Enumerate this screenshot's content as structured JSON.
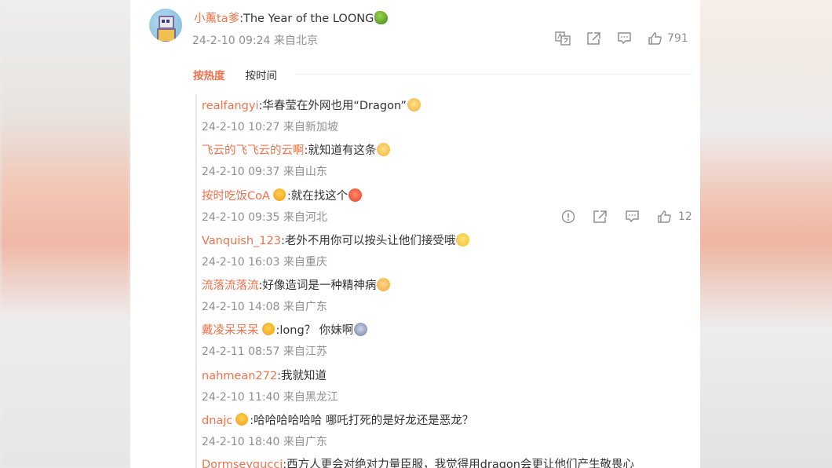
{
  "post": {
    "author": "小薰ta爹",
    "text": ":The Year of the LOONG",
    "emoji": "dragon-emoji",
    "meta": "24-2-10 09:24 来自北京",
    "like_count": "791",
    "icons": [
      "translate-icon",
      "share-icon",
      "comment-icon",
      "like-icon"
    ]
  },
  "tabs": {
    "hot": "按热度",
    "time": "按时间"
  },
  "replies": [
    {
      "user": "realfangyi",
      "text": ":华春莹在外网也用“Dragon”",
      "emoji": "cat",
      "meta": "24-2-10 10:27 来自新加坡",
      "badge": false
    },
    {
      "user": "飞云的飞飞云的云啊",
      "text": ":就知道有这条",
      "emoji": "cat",
      "meta": "24-2-10 09:37 来自山东",
      "badge": false
    },
    {
      "user": "按时吃饭CoA",
      "text": ":就在找这个",
      "emoji": "angry",
      "meta": "24-2-10 09:35 来自河北",
      "badge": true
    },
    {
      "user": "Vanquish_123",
      "text": ":老外不用你可以按头让他们接受哦",
      "emoji": "smile",
      "meta": "24-2-10 16:03 来自重庆",
      "badge": false
    },
    {
      "user": "流落流落流",
      "text": ":好像造词是一种精神病",
      "emoji": "clap",
      "meta": "24-2-10 14:08 来自广东",
      "badge": false
    },
    {
      "user": "戴凌呆呆呆",
      "text": ":long？ 你妹啊",
      "emoji": "mask",
      "meta": "24-2-11 08:57 来自江苏",
      "badge": true
    },
    {
      "user": "nahmean272",
      "text": ":我就知道",
      "emoji": "",
      "meta": "24-2-10 11:40 来自黑龙江",
      "badge": false
    },
    {
      "user": "dnajc",
      "text": ":哈哈哈哈哈哈 哪吒打死的是好龙还是恶龙？",
      "emoji": "",
      "meta": "24-2-10 18:40 来自广东",
      "badge": true
    },
    {
      "user": "Dormseyqucci",
      "text": ":西方人更会对绝对力量臣服，我觉得用dragon会更让他们产生敬畏心",
      "emoji": "",
      "meta": "",
      "badge": false
    }
  ],
  "reply_actions": {
    "like_count": "12",
    "icons": [
      "report-icon",
      "share-icon",
      "comment-icon",
      "like-icon"
    ]
  }
}
